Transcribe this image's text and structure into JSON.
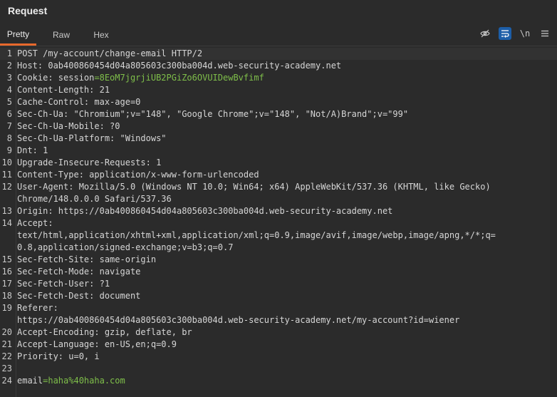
{
  "panel": {
    "title": "Request"
  },
  "tabs": [
    {
      "label": "Pretty",
      "active": true
    },
    {
      "label": "Raw",
      "active": false
    },
    {
      "label": "Hex",
      "active": false
    }
  ],
  "toolbar": {
    "hide_icon": "eye-off-icon",
    "wrap_icon": "word-wrap-icon",
    "newline_label": "\\n",
    "menu_icon": "menu-icon",
    "accent": "#1d5ea8"
  },
  "colors": {
    "tab_indicator": "#e8692c",
    "value_green": "#7fbf4a"
  },
  "lines": [
    {
      "n": "1",
      "text": "POST /my-account/change-email HTTP/2"
    },
    {
      "n": "2",
      "text": "Host: 0ab400860454d04a805603c300ba004d.web-security-academy.net"
    },
    {
      "n": "3",
      "key": "Cookie: session",
      "eq": "=",
      "val": "8EoM7jgrjiUB2PGiZo6OVUIDewBvfimf"
    },
    {
      "n": "4",
      "text": "Content-Length: 21"
    },
    {
      "n": "5",
      "text": "Cache-Control: max-age=0"
    },
    {
      "n": "6",
      "text": "Sec-Ch-Ua: \"Chromium\";v=\"148\", \"Google Chrome\";v=\"148\", \"Not/A)Brand\";v=\"99\""
    },
    {
      "n": "7",
      "text": "Sec-Ch-Ua-Mobile: ?0"
    },
    {
      "n": "8",
      "text": "Sec-Ch-Ua-Platform: \"Windows\""
    },
    {
      "n": "9",
      "text": "Dnt: 1"
    },
    {
      "n": "10",
      "text": "Upgrade-Insecure-Requests: 1"
    },
    {
      "n": "11",
      "text": "Content-Type: application/x-www-form-urlencoded"
    },
    {
      "n": "12",
      "text": "User-Agent: Mozilla/5.0 (Windows NT 10.0; Win64; x64) AppleWebKit/537.36 (KHTML, like Gecko)"
    },
    {
      "n": "",
      "text": "Chrome/148.0.0.0 Safari/537.36"
    },
    {
      "n": "13",
      "text": "Origin: https://0ab400860454d04a805603c300ba004d.web-security-academy.net"
    },
    {
      "n": "14",
      "text": "Accept:"
    },
    {
      "n": "",
      "text": "text/html,application/xhtml+xml,application/xml;q=0.9,image/avif,image/webp,image/apng,*/*;q="
    },
    {
      "n": "",
      "text": "0.8,application/signed-exchange;v=b3;q=0.7"
    },
    {
      "n": "15",
      "text": "Sec-Fetch-Site: same-origin"
    },
    {
      "n": "16",
      "text": "Sec-Fetch-Mode: navigate"
    },
    {
      "n": "17",
      "text": "Sec-Fetch-User: ?1"
    },
    {
      "n": "18",
      "text": "Sec-Fetch-Dest: document"
    },
    {
      "n": "19",
      "text": "Referer:"
    },
    {
      "n": "",
      "text": "https://0ab400860454d04a805603c300ba004d.web-security-academy.net/my-account?id=wiener"
    },
    {
      "n": "20",
      "text": "Accept-Encoding: gzip, deflate, br"
    },
    {
      "n": "21",
      "text": "Accept-Language: en-US,en;q=0.9"
    },
    {
      "n": "22",
      "text": "Priority: u=0, i"
    },
    {
      "n": "23",
      "text": ""
    },
    {
      "n": "24",
      "key": "email",
      "eq": "=",
      "val": "haha%40haha.com"
    }
  ]
}
